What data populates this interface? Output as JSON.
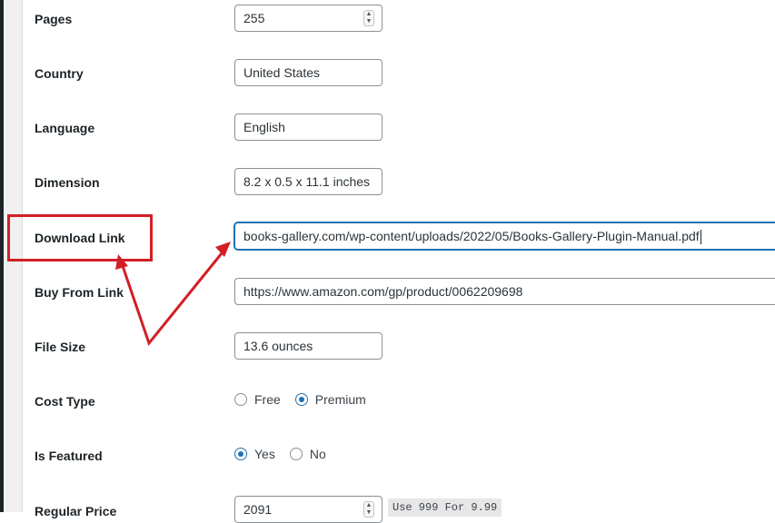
{
  "fields": {
    "pages": {
      "label": "Pages",
      "value": "255"
    },
    "country": {
      "label": "Country",
      "value": "United States"
    },
    "language": {
      "label": "Language",
      "value": "English"
    },
    "dimension": {
      "label": "Dimension",
      "value": "8.2 x 0.5 x 11.1 inches"
    },
    "download_link": {
      "label": "Download Link",
      "value": "books-gallery.com/wp-content/uploads/2022/05/Books-Gallery-Plugin-Manual.pdf"
    },
    "buy_from_link": {
      "label": "Buy From Link",
      "value": "https://www.amazon.com/gp/product/0062209698"
    },
    "file_size": {
      "label": "File Size",
      "value": "13.6 ounces"
    },
    "cost_type": {
      "label": "Cost Type",
      "options": [
        "Free",
        "Premium"
      ],
      "selected": "Premium"
    },
    "is_featured": {
      "label": "Is Featured",
      "options": [
        "Yes",
        "No"
      ],
      "selected": "Yes"
    },
    "regular_price": {
      "label": "Regular Price",
      "value": "2091",
      "hint": "Use 999 For 9.99"
    }
  },
  "colors": {
    "annotation": "#d21f26",
    "accent": "#2271b1"
  }
}
